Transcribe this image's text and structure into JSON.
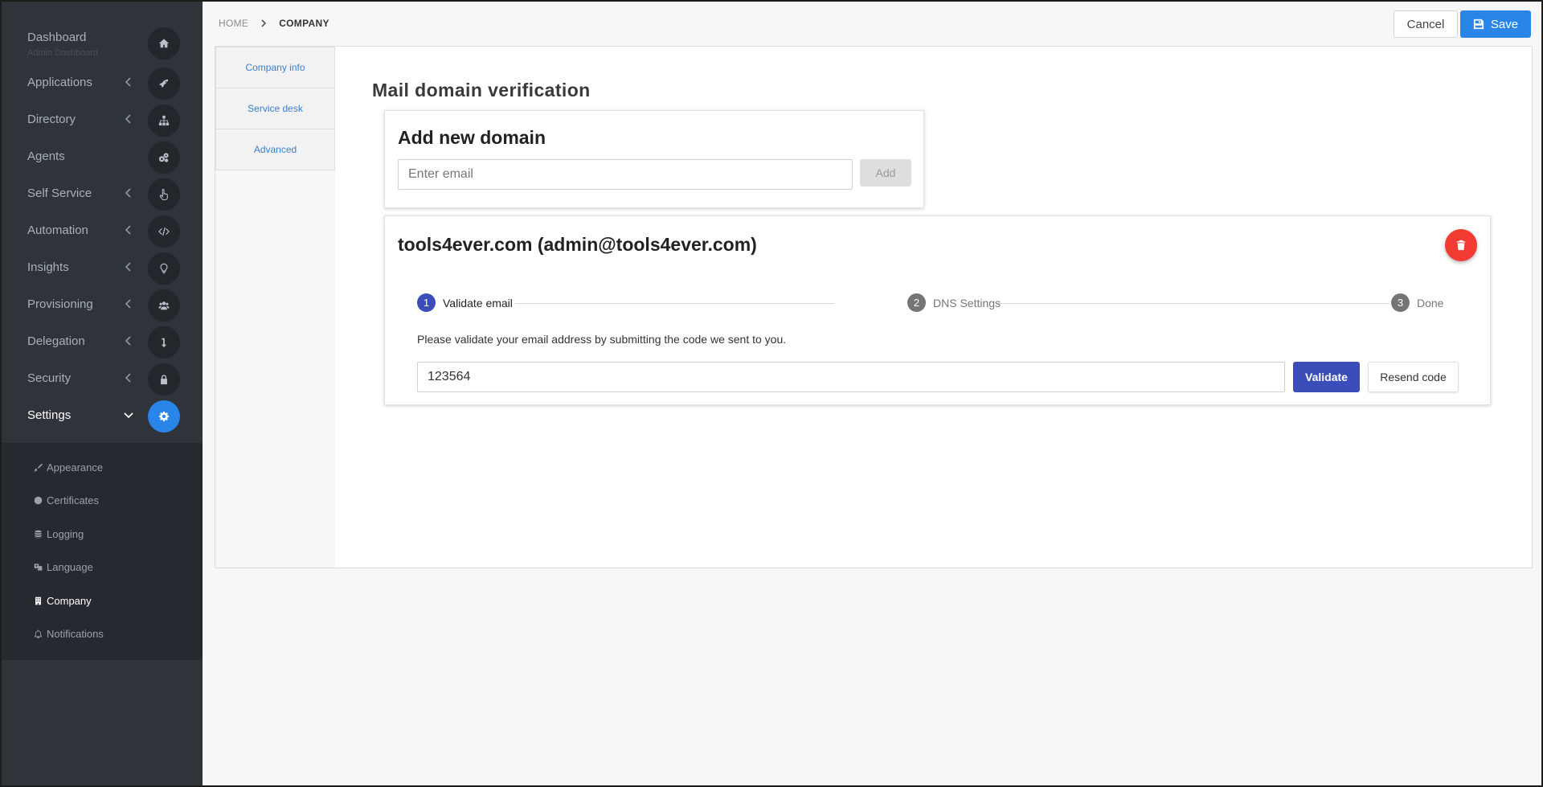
{
  "sidebar": {
    "dashboard": {
      "label": "Dashboard",
      "sublabel": "Admin Dashboard",
      "icon": "home-icon"
    },
    "items": [
      {
        "label": "Applications",
        "icon": "rocket-icon"
      },
      {
        "label": "Directory",
        "icon": "sitemap-icon"
      },
      {
        "label": "Agents",
        "icon": "cogs-icon"
      },
      {
        "label": "Self Service",
        "icon": "hand-pointer-icon"
      },
      {
        "label": "Automation",
        "icon": "code-icon"
      },
      {
        "label": "Insights",
        "icon": "lightbulb-icon"
      },
      {
        "label": "Provisioning",
        "icon": "users-icon"
      },
      {
        "label": "Delegation",
        "icon": "level-down-icon"
      },
      {
        "label": "Security",
        "icon": "lock-icon"
      },
      {
        "label": "Settings",
        "icon": "gear-icon",
        "active": true
      }
    ],
    "settings_sub": [
      {
        "label": "Appearance",
        "icon": "paint-brush-icon"
      },
      {
        "label": "Certificates",
        "icon": "circle-icon"
      },
      {
        "label": "Logging",
        "icon": "database-icon"
      },
      {
        "label": "Language",
        "icon": "language-icon"
      },
      {
        "label": "Company",
        "icon": "building-icon",
        "active": true
      },
      {
        "label": "Notifications",
        "icon": "bell-icon"
      }
    ]
  },
  "breadcrumb": {
    "home": "HOME",
    "current": "COMPANY"
  },
  "toolbar": {
    "cancel_label": "Cancel",
    "save_label": "Save"
  },
  "tabs": [
    {
      "label": "Company info"
    },
    {
      "label": "Service desk"
    },
    {
      "label": "Advanced"
    }
  ],
  "main": {
    "section_title": "Mail domain verification",
    "add_domain": {
      "title": "Add new domain",
      "email_placeholder": "Enter email",
      "add_label": "Add"
    },
    "domain": {
      "title": "tools4ever.com (admin@tools4ever.com)",
      "steps": [
        {
          "number": "1",
          "label": "Validate email"
        },
        {
          "number": "2",
          "label": "DNS Settings"
        },
        {
          "number": "3",
          "label": "Done"
        }
      ],
      "instruction": "Please validate your email address by submitting the code we sent to you.",
      "code_value": "123564",
      "validate_label": "Validate",
      "resend_label": "Resend code"
    }
  },
  "colors": {
    "sidebar_bg": "#2f333a",
    "accent": "#2a85e8",
    "step_active": "#3b4db8",
    "delete": "#f23b33"
  }
}
